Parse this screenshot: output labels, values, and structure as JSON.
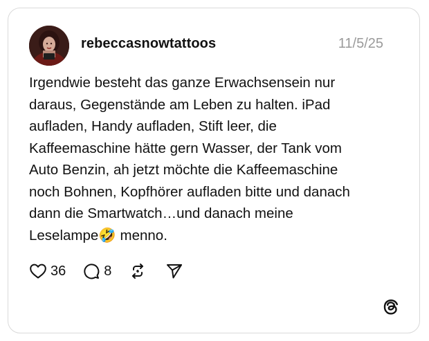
{
  "post": {
    "username": "rebeccasnowtattoos",
    "date": "11/5/25",
    "text": "Irgendwie besteht das ganze Erwachsensein nur\ndaraus, Gegenstände am Leben zu halten. iPad\naufladen, Handy aufladen, Stift leer, die\nKaffeemaschine hätte gern Wasser, der Tank vom\nAuto Benzin, ah jetzt möchte die Kaffeemaschine\nnoch Bohnen, Kopfhörer aufladen bitte und danach\ndann die Smartwatch…und danach meine\nLeselampe🤣 menno."
  },
  "actions": {
    "likes": "36",
    "replies": "8"
  },
  "icons": {
    "like": "heart-icon",
    "reply": "comment-icon",
    "repost": "repost-icon",
    "share": "send-icon",
    "brand": "threads-logo-icon"
  }
}
